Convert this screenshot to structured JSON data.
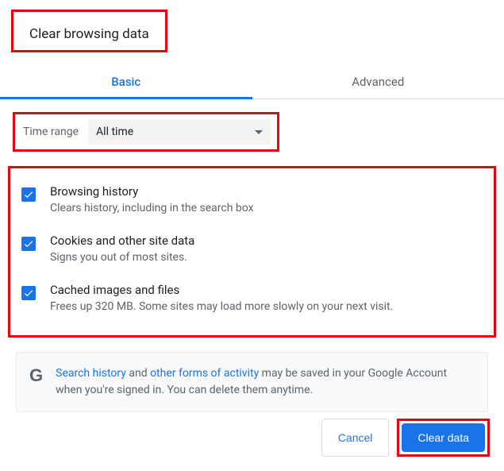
{
  "title": "Clear browsing data",
  "tabs": {
    "basic": "Basic",
    "advanced": "Advanced"
  },
  "range": {
    "label": "Time range",
    "value": "All time"
  },
  "options": [
    {
      "label": "Browsing history",
      "desc": "Clears history, including in the search box"
    },
    {
      "label": "Cookies and other site data",
      "desc": "Signs you out of most sites."
    },
    {
      "label": "Cached images and files",
      "desc": "Frees up 320 MB. Some sites may load more slowly on your next visit."
    }
  ],
  "info": {
    "link1": "Search history",
    "mid1": " and ",
    "link2": "other forms of activity",
    "rest": " may be saved in your Google Account when you're signed in. You can delete them anytime."
  },
  "buttons": {
    "cancel": "Cancel",
    "clear": "Clear data"
  }
}
